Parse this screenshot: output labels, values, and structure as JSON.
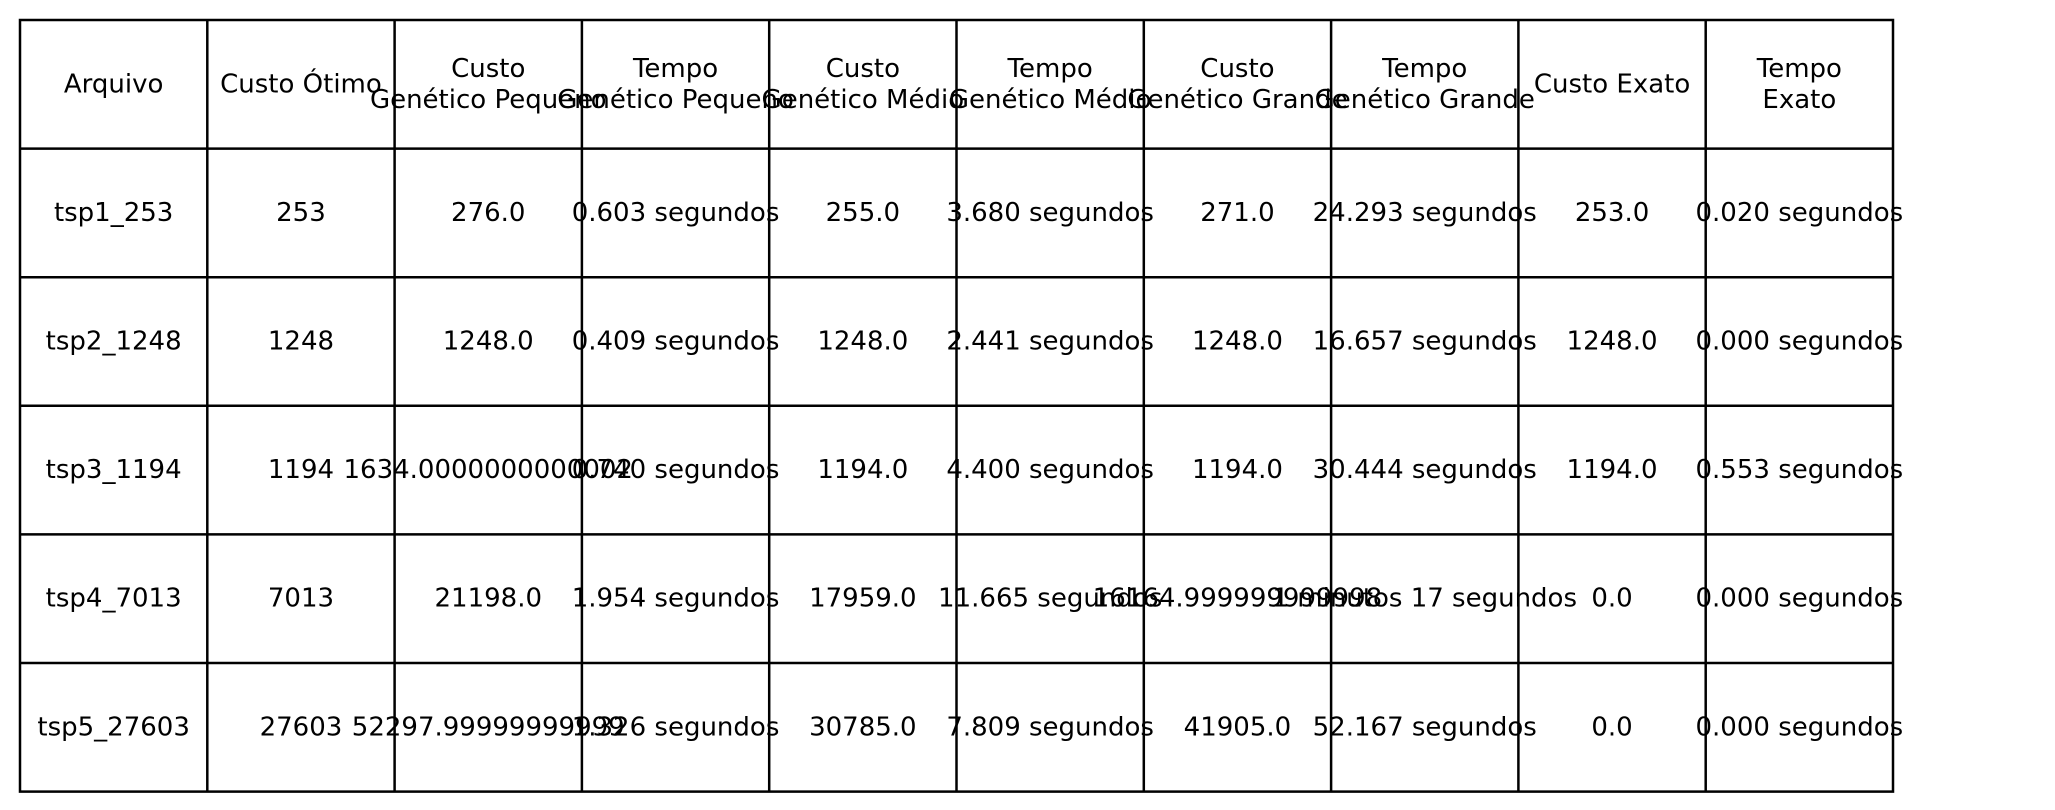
{
  "chart_data": {
    "type": "table",
    "columns": [
      [
        "Arquivo"
      ],
      [
        "Custo Ótimo"
      ],
      [
        "Custo",
        "Genético Pequeno"
      ],
      [
        "Tempo",
        "Genético Pequeno"
      ],
      [
        "Custo",
        "Genético Médio"
      ],
      [
        "Tempo",
        "Genético Médio"
      ],
      [
        "Custo",
        "Genético Grande"
      ],
      [
        "Tempo",
        "Genético Grande"
      ],
      [
        "Custo Exato"
      ],
      [
        "Tempo",
        "Exato"
      ]
    ],
    "rows": [
      [
        "tsp1_253",
        "253",
        "276.0",
        "0.603 segundos",
        "255.0",
        "3.680 segundos",
        "271.0",
        "24.293 segundos",
        "253.0",
        "0.020 segundos"
      ],
      [
        "tsp2_1248",
        "1248",
        "1248.0",
        "0.409 segundos",
        "1248.0",
        "2.441 segundos",
        "1248.0",
        "16.657 segundos",
        "1248.0",
        "0.000 segundos"
      ],
      [
        "tsp3_1194",
        "1194",
        "1634.0000000000002",
        "0.740 segundos",
        "1194.0",
        "4.400 segundos",
        "1194.0",
        "30.444 segundos",
        "1194.0",
        "0.553 segundos"
      ],
      [
        "tsp4_7013",
        "7013",
        "21198.0",
        "1.954 segundos",
        "17959.0",
        "11.665 segundos",
        "16164.999999999998",
        "1 minutos 17 segundos",
        "0.0",
        "0.000 segundos"
      ],
      [
        "tsp5_27603",
        "27603",
        "52297.99999999999",
        "1.326 segundos",
        "30785.0",
        "7.809 segundos",
        "41905.0",
        "52.167 segundos",
        "0.0",
        "0.000 segundos"
      ]
    ],
    "line_color": "#000000",
    "text_color": "#000000",
    "background": "#ffffff"
  }
}
